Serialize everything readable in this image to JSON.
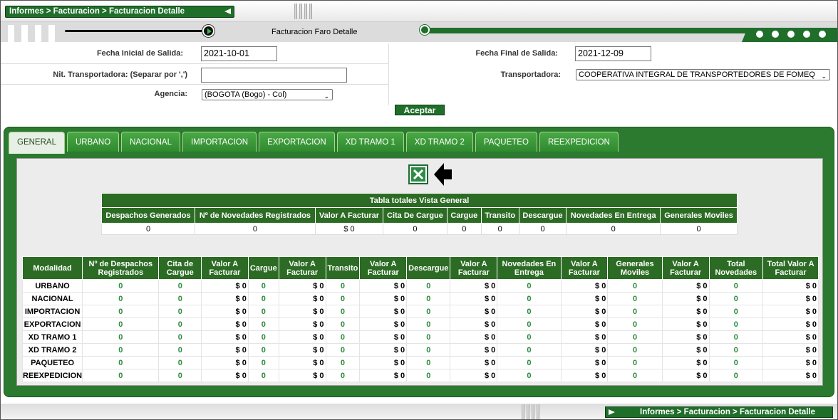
{
  "breadcrumb": "Informes > Facturacion > Facturacion Detalle",
  "page_title": "Facturacion Faro Detalle",
  "form": {
    "fecha_inicial_label": "Fecha Inicial de Salida:",
    "fecha_inicial_value": "2021-10-01",
    "fecha_final_label": "Fecha Final de Salida:",
    "fecha_final_value": "2021-12-09",
    "nit_label": "Nit. Transportadora:   (Separar por ',')",
    "nit_value": "",
    "transportadora_label": "Transportadora:",
    "transportadora_value": "COOPERATIVA INTEGRAL DE TRANSPORTEDORES DE FOMEQ",
    "agencia_label": "Agencia:",
    "agencia_value": "(BOGOTA (Bogo) - Col)",
    "aceptar_label": "Aceptar"
  },
  "tabs": [
    "GENERAL",
    "URBANO",
    "NACIONAL",
    "IMPORTACION",
    "EXPORTACION",
    "XD TRAMO 1",
    "XD TRAMO 2",
    "PAQUETEO",
    "REEXPEDICION"
  ],
  "active_tab": "GENERAL",
  "icons": {
    "excel": "excel-export-icon",
    "arrow": "arrow-left-icon"
  },
  "colors": {
    "brand_green": "#2c6b24",
    "panel_green": "#2c7a2f",
    "value_green": "#2a8a3a"
  },
  "summary_table": {
    "caption": "Tabla totales Vista General",
    "headers": [
      "Despachos Generados",
      "Nº de Novedades Registrados",
      "Valor A Facturar",
      "Cita De Cargue",
      "Cargue",
      "Transito",
      "Descargue",
      "Novedades En Entrega",
      "Generales Moviles"
    ],
    "values": [
      "0",
      "0",
      "$ 0",
      "0",
      "0",
      "0",
      "0",
      "0",
      "0"
    ]
  },
  "detail_table": {
    "headers": [
      "Modalidad",
      "Nº de Despachos Registrados",
      "Cita de Cargue",
      "Valor A Facturar",
      "Cargue",
      "Valor A Facturar",
      "Transito",
      "Valor A Facturar",
      "Descargue",
      "Valor A Facturar",
      "Novedades En Entrega",
      "Valor A Facturar",
      "Generales Moviles",
      "Valor A Facturar",
      "Total Novedades",
      "Total Valor A Facturar"
    ],
    "rows": [
      [
        "URBANO",
        "0",
        "0",
        "$ 0",
        "0",
        "$ 0",
        "0",
        "$ 0",
        "0",
        "$ 0",
        "0",
        "$ 0",
        "0",
        "$ 0",
        "0",
        "$ 0"
      ],
      [
        "NACIONAL",
        "0",
        "0",
        "$ 0",
        "0",
        "$ 0",
        "0",
        "$ 0",
        "0",
        "$ 0",
        "0",
        "$ 0",
        "0",
        "$ 0",
        "0",
        "$ 0"
      ],
      [
        "IMPORTACION",
        "0",
        "0",
        "$ 0",
        "0",
        "$ 0",
        "0",
        "$ 0",
        "0",
        "$ 0",
        "0",
        "$ 0",
        "0",
        "$ 0",
        "0",
        "$ 0"
      ],
      [
        "EXPORTACION",
        "0",
        "0",
        "$ 0",
        "0",
        "$ 0",
        "0",
        "$ 0",
        "0",
        "$ 0",
        "0",
        "$ 0",
        "0",
        "$ 0",
        "0",
        "$ 0"
      ],
      [
        "XD TRAMO 1",
        "0",
        "0",
        "$ 0",
        "0",
        "$ 0",
        "0",
        "$ 0",
        "0",
        "$ 0",
        "0",
        "$ 0",
        "0",
        "$ 0",
        "0",
        "$ 0"
      ],
      [
        "XD TRAMO 2",
        "0",
        "0",
        "$ 0",
        "0",
        "$ 0",
        "0",
        "$ 0",
        "0",
        "$ 0",
        "0",
        "$ 0",
        "0",
        "$ 0",
        "0",
        "$ 0"
      ],
      [
        "PAQUETEO",
        "0",
        "0",
        "$ 0",
        "0",
        "$ 0",
        "0",
        "$ 0",
        "0",
        "$ 0",
        "0",
        "$ 0",
        "0",
        "$ 0",
        "0",
        "$ 0"
      ],
      [
        "REEXPEDICION",
        "0",
        "0",
        "$ 0",
        "0",
        "$ 0",
        "0",
        "$ 0",
        "0",
        "$ 0",
        "0",
        "$ 0",
        "0",
        "$ 0",
        "0",
        "$ 0"
      ]
    ]
  }
}
